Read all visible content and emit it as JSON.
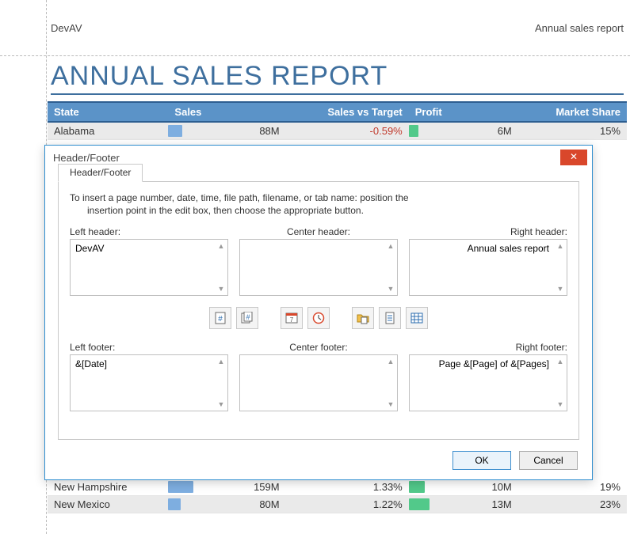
{
  "header": {
    "left": "DevAV",
    "right": "Annual sales report"
  },
  "report_title": "ANNUAL SALES REPORT",
  "columns": {
    "state": "State",
    "sales": "Sales",
    "sales_vs_target": "Sales vs Target",
    "profit": "Profit",
    "market_share": "Market Share"
  },
  "rows": [
    {
      "state": "Alabama",
      "sales_bar": 18,
      "sales": "88M",
      "svt": "-0.59%",
      "svt_neg": true,
      "profit_bar": 12,
      "profit": "6M",
      "share": "15%",
      "alt": true
    },
    {
      "state": "New Hampshire",
      "sales_bar": 32,
      "sales": "159M",
      "svt": "1.33%",
      "svt_neg": false,
      "profit_bar": 20,
      "profit": "10M",
      "share": "19%",
      "alt": false
    },
    {
      "state": "New Mexico",
      "sales_bar": 16,
      "sales": "80M",
      "svt": "1.22%",
      "svt_neg": false,
      "profit_bar": 26,
      "profit": "13M",
      "share": "23%",
      "alt": true
    }
  ],
  "dialog": {
    "title": "Header/Footer",
    "tab_label": "Header/Footer",
    "instruction_l1": "To insert a page number, date, time, file path, filename, or tab name: position the",
    "instruction_l2": "insertion point in the edit box, then choose the appropriate button.",
    "labels": {
      "left_header": "Left header:",
      "center_header": "Center header:",
      "right_header": "Right header:",
      "left_footer": "Left footer:",
      "center_footer": "Center footer:",
      "right_footer": "Right footer:"
    },
    "values": {
      "left_header": "DevAV",
      "center_header": "",
      "right_header": "Annual sales report",
      "left_footer": "&[Date]",
      "center_footer": "",
      "right_footer": "Page &[Page] of &[Pages]"
    },
    "tool_names": {
      "page": "insert-page-number-icon",
      "pages": "insert-total-pages-icon",
      "date": "insert-date-icon",
      "time": "insert-time-icon",
      "path": "insert-file-path-icon",
      "file": "insert-file-name-icon",
      "sheet": "insert-sheet-name-icon"
    },
    "buttons": {
      "ok": "OK",
      "cancel": "Cancel"
    }
  }
}
